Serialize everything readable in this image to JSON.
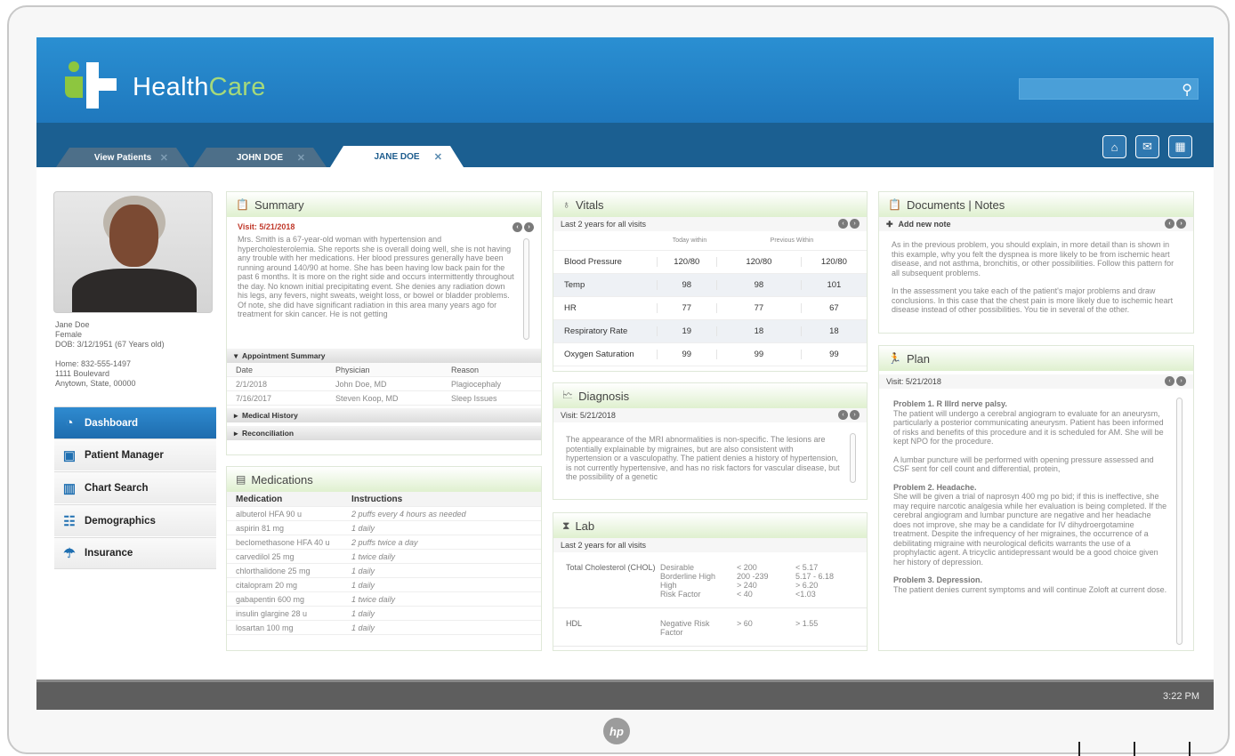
{
  "app": {
    "brand_a": "Health",
    "brand_b": "Care",
    "time": "3:22 PM",
    "search_placeholder": ""
  },
  "tabs": [
    {
      "label": "View Patients",
      "close": "✕"
    },
    {
      "label": "JOHN DOE",
      "close": "✕"
    },
    {
      "label": "JANE DOE",
      "close": "✕"
    }
  ],
  "patient": {
    "name": "Jane Doe",
    "sex": "Female",
    "dob": "DOB: 3/12/1951 (67 Years old)",
    "phone": "Home: 832-555-1497",
    "address1": "1111 Boulevard",
    "address2": "Anytown, State, 00000"
  },
  "nav": [
    {
      "label": "Dashboard",
      "icon": "speedometer-icon"
    },
    {
      "label": "Patient Manager",
      "icon": "briefcase-icon"
    },
    {
      "label": "Chart Search",
      "icon": "bar-chart-icon"
    },
    {
      "label": "Demographics",
      "icon": "people-icon"
    },
    {
      "label": "Insurance",
      "icon": "umbrella-icon"
    }
  ],
  "summary": {
    "title": "Summary",
    "visit": "Visit: 5/21/2018",
    "text": "Mrs. Smith is a 67-year-old woman with hypertension and hypercholesterolemia. She reports she is overall doing well, she is not having any trouble with her medications. Her blood pressures generally have been running around 140/90 at home. She has been having low back pain for the past 6 months. It is more on the right side and occurs intermittently throughout the day. No known initial precipitating event. She denies any radiation down his legs, any fevers, night sweats, weight loss, or bowel or bladder problems. Of note, she did have significant radiation in this area many years ago for treatment for skin cancer. He is not getting",
    "appt_title": "Appointment Summary",
    "appt_headers": [
      "Date",
      "Physician",
      "Reason"
    ],
    "appts": [
      [
        "2/1/2018",
        "John Doe, MD",
        "Plagiocephaly"
      ],
      [
        "7/16/2017",
        "Steven Koop, MD",
        "Sleep Issues"
      ]
    ],
    "medical_history": "Medical History",
    "reconciliation": "Reconciliation"
  },
  "medications": {
    "title": "Medications",
    "headers": [
      "Medication",
      "Instructions"
    ],
    "items": [
      [
        "albuterol HFA 90 u",
        "2 puffs every 4 hours as needed"
      ],
      [
        "aspirin 81 mg",
        "1 daily"
      ],
      [
        "beclomethasone HFA 40 u",
        "2 puffs twice a day"
      ],
      [
        "carvedilol 25 mg",
        "1 twice daily"
      ],
      [
        "chlorthalidone 25 mg",
        "1 daily"
      ],
      [
        "citalopram 20 mg",
        "1 daily"
      ],
      [
        "gabapentin 600 mg",
        "1 twice daily"
      ],
      [
        "insulin glargine 28 u",
        "1 daily"
      ],
      [
        "losartan 100 mg",
        "1 daily"
      ]
    ]
  },
  "vitals": {
    "title": "Vitals",
    "sub": "Last 2 years for all visits",
    "col_today": "Today within",
    "col_prev": "Previous Within",
    "rows": [
      [
        "Blood Pressure",
        "120/80",
        "120/80",
        "120/80"
      ],
      [
        "Temp",
        "98",
        "98",
        "101"
      ],
      [
        "HR",
        "77",
        "77",
        "67"
      ],
      [
        "Respiratory Rate",
        "19",
        "18",
        "18"
      ],
      [
        "Oxygen Saturation",
        "99",
        "99",
        "99"
      ]
    ]
  },
  "diagnosis": {
    "title": "Diagnosis",
    "visit": "Visit: 5/21/2018",
    "text": "The appearance of the MRI abnormalities is non-specific. The lesions are potentially explainable by migraines, but are also consistent with hypertension or a vasculopathy. The patient denies a history of hypertension, is not currently hypertensive, and has no risk factors for vascular disease, but the possibility of a genetic"
  },
  "lab": {
    "title": "Lab",
    "sub": "Last 2 years for all visits",
    "rows": [
      {
        "name": "Total Cholesterol (CHOL)",
        "labels": "Desirable\nBorderline High\nHigh\nRisk Factor",
        "ranges": "< 200\n200 -239\n> 240\n< 40",
        "mmol": "< 5.17\n5.17 - 6.18\n> 6.20\n<1.03"
      },
      {
        "name": "HDL",
        "labels": "Negative Risk\nFactor",
        "ranges": "> 60",
        "mmol": "> 1.55"
      }
    ]
  },
  "documents": {
    "title": "Documents | Notes",
    "add": "Add new note",
    "p1": "As in the previous problem, you should explain, in more detail than is shown in this example, why you felt the dyspnea is more likely to be from ischemic heart disease, and not asthma, bronchitis, or other possibilities. Follow this pattern for all subsequent problems.",
    "p2": "In the assessment you take each of the patient's major problems and draw conclusions. In this case that the chest pain is more likely due to ischemic heart disease instead of other possibilities. You tie in several of the other."
  },
  "plan": {
    "title": "Plan",
    "visit": "Visit: 5/21/2018",
    "p1h": "Problem 1. R IIIrd nerve palsy.",
    "p1": "The patient will undergo a cerebral angiogram to evaluate for an aneurysm, particularly a posterior communicating aneurysm. Patient has been informed of risks and benefits of this procedure and it is scheduled for AM. She will be kept NPO for the procedure.",
    "p1b": "A lumbar puncture will be performed with opening pressure assessed and CSF sent for cell count and differential, protein,",
    "p2h": "Problem 2. Headache.",
    "p2": "She will be given a trial of naprosyn 400 mg po bid; if this is ineffective, she may require narcotic analgesia while her evaluation is being completed. If the cerebral angiogram and lumbar puncture are negative and her headache does not improve, she may be a candidate for IV dihydroergotamine treatment. Despite the infrequency of her migraines, the occurrence of a debilitating migraine with neurological deficits warrants the use of a prophylactic agent. A tricyclic antidepressant would be a good choice given her history of depression.",
    "p3h": "Problem 3. Depression.",
    "p3": "The patient denies current symptoms and will continue Zoloft at current dose."
  }
}
